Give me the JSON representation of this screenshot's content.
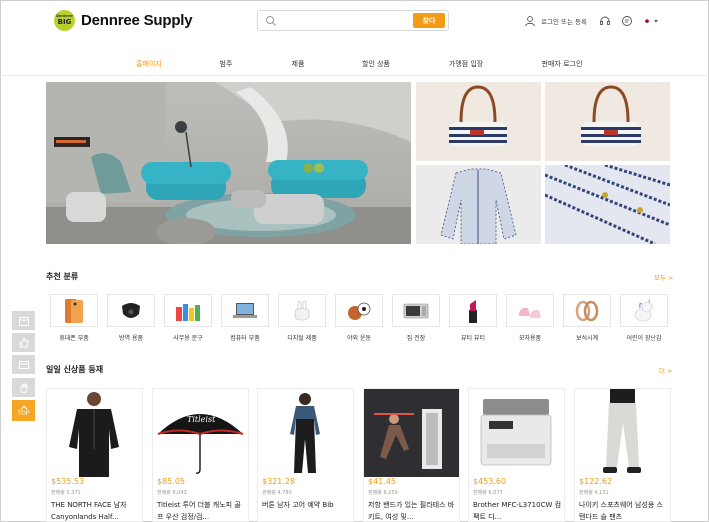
{
  "header": {
    "logo_badge_top": "Dennree",
    "logo_badge_bottom": "BIG",
    "logo_text": "Dennree Supply",
    "search_placeholder": "",
    "search_button": "찾다",
    "login_label": "로그인 또는 등록"
  },
  "nav": {
    "items": [
      "홈페이지",
      "범주",
      "제품",
      "할인 상품",
      "가맹점 입장",
      "판매자 로그인"
    ]
  },
  "recommended": {
    "title": "추천 분류",
    "more": "모두 >",
    "categories": [
      {
        "label": "휴대폰 부품",
        "icon": "phone-case-icon"
      },
      {
        "label": "방역 용품",
        "icon": "face-mask-icon"
      },
      {
        "label": "사무용 문구",
        "icon": "stationery-icon"
      },
      {
        "label": "컴퓨터 부품",
        "icon": "laptop-icon"
      },
      {
        "label": "디지털 제품",
        "icon": "earbuds-icon"
      },
      {
        "label": "야외 운동",
        "icon": "sports-balls-icon"
      },
      {
        "label": "집 전장",
        "icon": "microwave-icon"
      },
      {
        "label": "뷰티 뷰티",
        "icon": "lipstick-icon"
      },
      {
        "label": "모자용품",
        "icon": "baby-shoes-icon"
      },
      {
        "label": "보석시계",
        "icon": "bracelet-icon"
      },
      {
        "label": "어린이 장난감",
        "icon": "unicorn-toy-icon"
      }
    ]
  },
  "daily": {
    "title": "일일 신상품 등재",
    "more": "더 >",
    "products": [
      {
        "price": "$535.53",
        "sold": "판매량 5,371",
        "name": "THE NORTH FACE 남자 Canyonlands Half..."
      },
      {
        "price": "$85.05",
        "sold": "판매량 8,043",
        "name": "Titleist 투어 더블 캐노피 골프 우산 검정/검..."
      },
      {
        "price": "$321.28",
        "sold": "판매량 4,780",
        "name": "버튼 남자 고어 예약 Bib"
      },
      {
        "price": "$41.45",
        "sold": "판매량 8,259",
        "name": "저항 밴드가 있는 필라테스 바 키트, 여성 및..."
      },
      {
        "price": "$453.60",
        "sold": "판매량 6,077",
        "name": "Brother MFC-L3710CW 컴팩트 디..."
      },
      {
        "price": "$122.62",
        "sold": "판매량 4,131",
        "name": "나이키 스포츠웨어 남성용 스탠다드 슬 팬츠"
      }
    ]
  },
  "side_widget": {
    "top_label": "TOP"
  },
  "colors": {
    "accent": "#f39b16",
    "logo_green": "#b9cf2a"
  }
}
